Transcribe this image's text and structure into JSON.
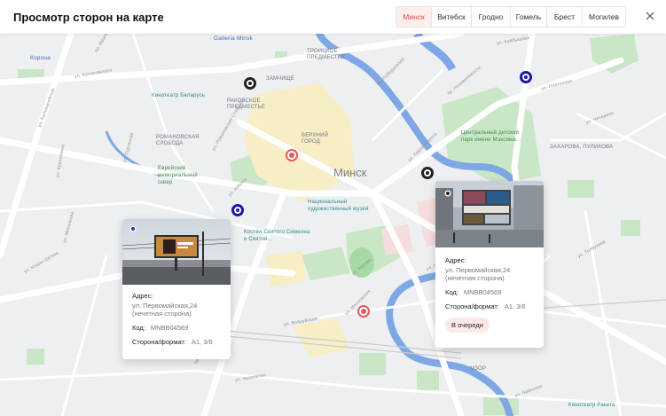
{
  "header": {
    "title": "Просмотр сторон на карте",
    "tabs": [
      "Минск",
      "Витебск",
      "Гродно",
      "Гомель",
      "Брест",
      "Могилев"
    ],
    "active_tab": "Минск"
  },
  "map": {
    "city_label": "Минск",
    "district_labels": [
      "Троицкое предместье",
      "Раковское предместье",
      "Романовская слобода",
      "Верхний город",
      "Захарова, Пулихова",
      "Замчище"
    ],
    "places": [
      "Galleria Minsk",
      "Корона",
      "Кинотеатр Беларусь",
      "Центральный детский парк имени Максима...",
      "Еврейский мемориальный сквер",
      "Национальный художественный музей",
      "Костёл Святого Симеона и Святой...",
      "Кинотеатр Ракета",
      "МЗОР"
    ],
    "streets": [
      "ул. Калиновского",
      "пр. Победителей",
      "пр. Независимости",
      "ул. Кальварийская",
      "ул. Романовская Слобода",
      "ул. Немига",
      "ул. Мясникова",
      "ул. Московская",
      "ул. Кирова",
      "ул. Бобруйская",
      "ул. Чичерина",
      "ул. Первомайская",
      "ул. Клары Цеткин",
      "пр. Дзержинского",
      "ул. Толбухина",
      "ул. Аранская",
      "ул. Сурганова",
      "ул. Платонова",
      "ул. Куйбышева",
      "пр. Машерова",
      "ул. Кропоткина",
      "ул. Червякова",
      "ул. Карла Маркса"
    ]
  },
  "cards": [
    {
      "address_label": "Адрес:",
      "address_value": "ул. Первомайская,24 (нечетная сторона)",
      "code_label": "Код:",
      "code_value": "MNBB04569",
      "side_label": "Сторона/формат:",
      "side_value": "A1, 3/6"
    },
    {
      "address_label": "Адрес:",
      "address_value": "ул. Первомайская,24 (нечетная сторона)",
      "code_label": "Код:",
      "code_value": "MNBB04569",
      "side_label": "Сторона/формат:",
      "side_value": "A1, 3/6",
      "status": "В очереди"
    }
  ],
  "colors": {
    "accent": "#e34b4b",
    "marker_black": "#222222",
    "marker_blue": "#1a1aa6",
    "marker_red": "#e55a5a",
    "badge_bg": "#fde8e8",
    "map_bg": "#eeeff1",
    "water": "#7fa8e6",
    "park": "#c8e6c5"
  },
  "icons": [
    "close-icon",
    "map-marker-icon"
  ]
}
